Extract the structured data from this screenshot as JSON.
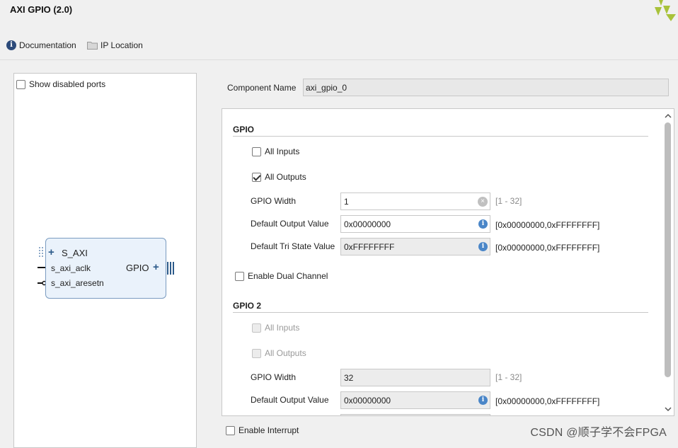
{
  "window": {
    "title": "AXI GPIO (2.0)"
  },
  "toolbar": {
    "documentation": "Documentation",
    "ip_location": "IP Location"
  },
  "left_panel": {
    "show_disabled_ports": "Show disabled ports",
    "block": {
      "s_axi": "S_AXI",
      "aclk": "s_axi_aclk",
      "aresetn": "s_axi_aresetn",
      "gpio": "GPIO"
    }
  },
  "component": {
    "label": "Component Name",
    "value": "axi_gpio_0"
  },
  "gpio": {
    "title": "GPIO",
    "all_inputs": {
      "label": "All Inputs",
      "checked": false
    },
    "all_outputs": {
      "label": "All Outputs",
      "checked": true
    },
    "width": {
      "label": "GPIO Width",
      "value": "1",
      "range": "[1 - 32]"
    },
    "default_output": {
      "label": "Default Output Value",
      "value": "0x00000000",
      "range": "[0x00000000,0xFFFFFFFF]"
    },
    "default_tri": {
      "label": "Default Tri State Value",
      "value": "0xFFFFFFFF",
      "range": "[0x00000000,0xFFFFFFFF]"
    }
  },
  "enable_dual_channel": {
    "label": "Enable Dual Channel",
    "checked": false
  },
  "gpio2": {
    "title": "GPIO 2",
    "all_inputs": {
      "label": "All Inputs"
    },
    "all_outputs": {
      "label": "All Outputs"
    },
    "width": {
      "label": "GPIO Width",
      "value": "32",
      "range": "[1 - 32]"
    },
    "default_output": {
      "label": "Default Output Value",
      "value": "0x00000000",
      "range": "[0x00000000,0xFFFFFFFF]"
    }
  },
  "enable_interrupt": {
    "label": "Enable Interrupt",
    "checked": false
  },
  "watermark": "CSDN @顺子学不会FPGA",
  "colors": {
    "logo": "#a8c23a",
    "info": "#4a86c8",
    "block_fill": "#eaf2fb",
    "block_border": "#7a9bc0"
  },
  "icons": [
    "info-icon",
    "folder-icon",
    "logo-icon",
    "clear-icon",
    "plus-icon",
    "scroll-up-icon",
    "scroll-down-icon"
  ]
}
